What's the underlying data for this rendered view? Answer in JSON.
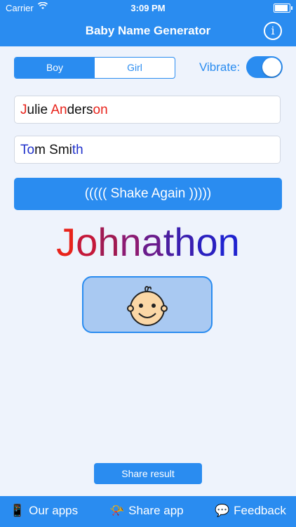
{
  "status": {
    "carrier": "Carrier",
    "time": "3:09 PM"
  },
  "nav": {
    "title": "Baby Name Generator",
    "info_icon": "i"
  },
  "segment": {
    "options": [
      "Boy",
      "Girl"
    ],
    "selected": "Boy"
  },
  "vibrate": {
    "label": "Vibrate:",
    "on": true
  },
  "parent1": {
    "value": "Julie Anderson",
    "segments": [
      {
        "t": "J",
        "c": "#e8231b"
      },
      {
        "t": "ulie ",
        "c": "#111111"
      },
      {
        "t": "An",
        "c": "#e8231b"
      },
      {
        "t": "ders",
        "c": "#111111"
      },
      {
        "t": "on",
        "c": "#e8231b"
      }
    ]
  },
  "parent2": {
    "value": "Tom Smith",
    "segments": [
      {
        "t": "To",
        "c": "#2233cc"
      },
      {
        "t": "m Smi",
        "c": "#111111"
      },
      {
        "t": "th",
        "c": "#2233cc"
      }
    ]
  },
  "shake_button": "((((( Shake Again )))))",
  "result": {
    "name": "Johnathon",
    "segments": [
      {
        "t": "J",
        "c": "#e8231b"
      },
      {
        "t": "o",
        "c": "#c4183a"
      },
      {
        "t": "h",
        "c": "#a01a52"
      },
      {
        "t": "n",
        "c": "#8c1b73"
      },
      {
        "t": "a",
        "c": "#6a1c8c"
      },
      {
        "t": "t",
        "c": "#4a1ea0"
      },
      {
        "t": "h",
        "c": "#3a1fb0"
      },
      {
        "t": "o",
        "c": "#2a20c0"
      },
      {
        "t": "n",
        "c": "#1f22cf"
      }
    ]
  },
  "baby_icon": "baby-face-icon",
  "share_result": "Share result",
  "tabs": [
    {
      "icon": "📱",
      "icon_name": "phone-icon",
      "label": "Our apps"
    },
    {
      "icon": "📯",
      "icon_name": "horn-icon",
      "label": "Share app"
    },
    {
      "icon": "💬",
      "icon_name": "speech-bubble-icon",
      "label": "Feedback"
    }
  ],
  "colors": {
    "accent": "#2a8cf0",
    "background": "#eef3fc"
  }
}
